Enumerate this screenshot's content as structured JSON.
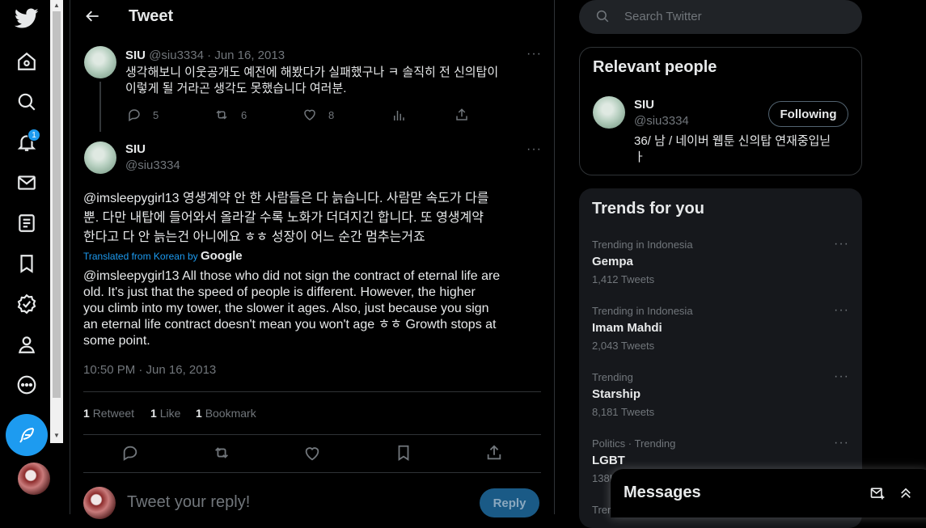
{
  "nav": {
    "notification_count": "1"
  },
  "header": {
    "title": "Tweet"
  },
  "parent_tweet": {
    "name": "SIU",
    "handle": "@siu3334",
    "date": "Jun 16, 2013",
    "text_line1": "생각해보니 이웃공개도 예전에 해봤다가 실패했구나 ㅋ  솔직히 전 신의탑이",
    "text_line2": "이렇게 될 거라곤 생각도 못했습니다 여러분.",
    "replies": "5",
    "retweets": "6",
    "likes": "8"
  },
  "main_tweet": {
    "name": "SIU",
    "handle": "@siu3334",
    "text_line1": "@imsleepygirl13  영생계약 안 한 사람들은 다 늙습니다.  사람맏 속도가 다를",
    "text_line2": "뿐.  다만 내탑에 들어와서 올라갈 수록 노화가 더뎌지긴 합니다. 또 영생계약",
    "text_line3": "한다고 다 안 늙는건 아니에요 ㅎㅎ 성장이 어느 순간 멈추는거죠",
    "translated_label": "Translated from Korean by",
    "translated_brand": "Google",
    "translation": [
      "@imsleepygirl13 All those who did not sign the contract of eternal life are",
      "old. It's just that the speed of people is different. However, the higher",
      "you climb into my tower, the slower it ages. Also, just because you sign",
      "an eternal life contract doesn't mean you won't age ㅎㅎ Growth stops at",
      "some point."
    ],
    "timestamp": "10:50 PM · Jun 16, 2013",
    "retweet_count": "1",
    "retweet_label": "Retweet",
    "like_count": "1",
    "like_label": "Like",
    "bookmark_count": "1",
    "bookmark_label": "Bookmark"
  },
  "reply": {
    "placeholder": "Tweet your reply!",
    "button": "Reply"
  },
  "search": {
    "placeholder": "Search Twitter"
  },
  "relevant": {
    "title": "Relevant people",
    "name": "SIU",
    "handle": "@siu3334",
    "follow_button": "Following",
    "bio_line1": "36/ 남 / 네이버 웹툰 신의탑 연재중입닏",
    "bio_line2": "ㅏ"
  },
  "trends": {
    "title": "Trends for you",
    "items": [
      {
        "meta": "Trending in Indonesia",
        "name": "Gempa",
        "count": "1,412 Tweets"
      },
      {
        "meta": "Trending in Indonesia",
        "name": "Imam Mahdi",
        "count": "2,043 Tweets"
      },
      {
        "meta": "Trending",
        "name": "Starship",
        "count": "8,181 Tweets"
      },
      {
        "meta": "Politics · Trending",
        "name": "LGBT",
        "count": "138K"
      },
      {
        "meta": "Tren"
      }
    ]
  },
  "messages": {
    "title": "Messages"
  },
  "colors": {
    "accent": "#1d9bf0",
    "background": "#000000",
    "text": "#e7e9ea",
    "muted": "#71767b"
  }
}
